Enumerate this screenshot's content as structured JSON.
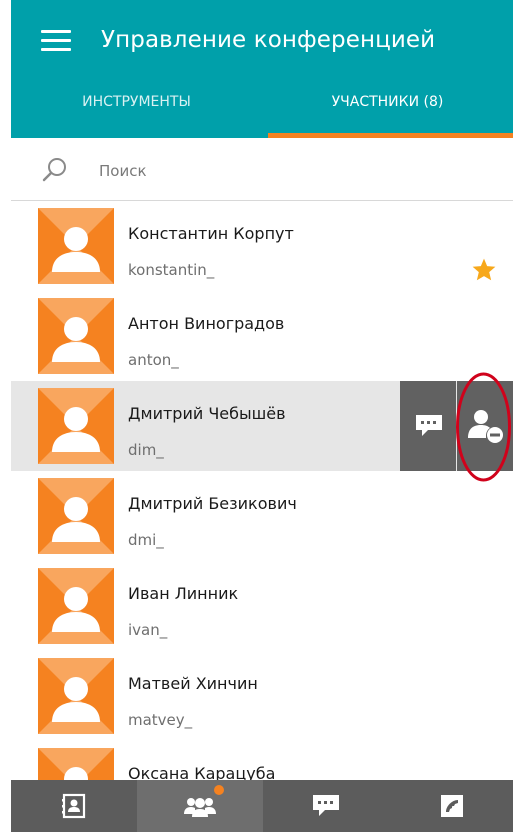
{
  "header": {
    "title": "Управление конференцией",
    "tabs": [
      {
        "label": "ИНСТРУМЕНТЫ",
        "active": false
      },
      {
        "label": "УЧАСТНИКИ (8)",
        "active": true
      }
    ]
  },
  "search": {
    "placeholder": "Поиск",
    "value": ""
  },
  "participants": [
    {
      "name": "Константин Корпут",
      "username": "konstantin_",
      "favorite": true
    },
    {
      "name": "Антон Виноградов",
      "username": "anton_"
    },
    {
      "name": "Дмитрий Чебышёв",
      "username": "dim_",
      "selected": true
    },
    {
      "name": "Дмитрий Безикович",
      "username": "dmi_"
    },
    {
      "name": "Иван Линник",
      "username": "ivan_"
    },
    {
      "name": "Матвей Хинчин",
      "username": "matvey_"
    },
    {
      "name": "Оксана Карацуба",
      "username": ""
    }
  ],
  "row_actions": {
    "chat_icon": "chat-bubble-icon",
    "remove_icon": "remove-user-icon"
  },
  "bottom_nav": [
    {
      "icon": "contacts-icon",
      "active": false
    },
    {
      "icon": "participants-icon",
      "active": true,
      "badge": true
    },
    {
      "icon": "chat-icon",
      "active": false
    },
    {
      "icon": "call-icon",
      "active": false
    }
  ],
  "colors": {
    "primary": "#00A0AA",
    "accent": "#F58220",
    "action_bg": "#616161",
    "bottom_bar": "#5C5C5C",
    "highlight_ring": "#D0021B"
  }
}
